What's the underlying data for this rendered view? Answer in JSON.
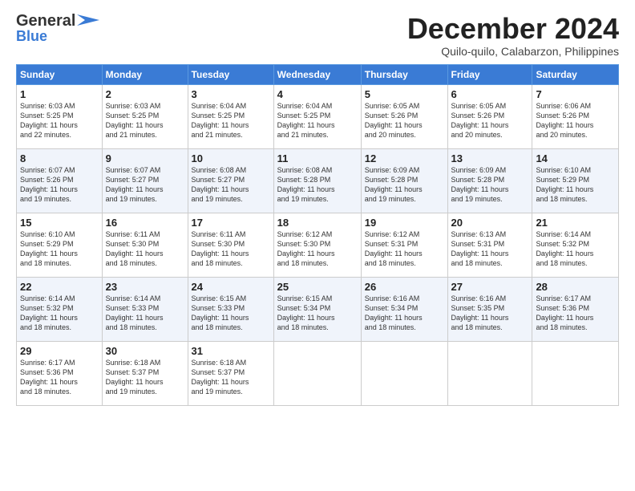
{
  "header": {
    "logo_general": "General",
    "logo_blue": "Blue",
    "month_title": "December 2024",
    "subtitle": "Quilo-quilo, Calabarzon, Philippines"
  },
  "weekdays": [
    "Sunday",
    "Monday",
    "Tuesday",
    "Wednesday",
    "Thursday",
    "Friday",
    "Saturday"
  ],
  "weeks": [
    [
      {
        "day": "1",
        "info": "Sunrise: 6:03 AM\nSunset: 5:25 PM\nDaylight: 11 hours\nand 22 minutes."
      },
      {
        "day": "2",
        "info": "Sunrise: 6:03 AM\nSunset: 5:25 PM\nDaylight: 11 hours\nand 21 minutes."
      },
      {
        "day": "3",
        "info": "Sunrise: 6:04 AM\nSunset: 5:25 PM\nDaylight: 11 hours\nand 21 minutes."
      },
      {
        "day": "4",
        "info": "Sunrise: 6:04 AM\nSunset: 5:25 PM\nDaylight: 11 hours\nand 21 minutes."
      },
      {
        "day": "5",
        "info": "Sunrise: 6:05 AM\nSunset: 5:26 PM\nDaylight: 11 hours\nand 20 minutes."
      },
      {
        "day": "6",
        "info": "Sunrise: 6:05 AM\nSunset: 5:26 PM\nDaylight: 11 hours\nand 20 minutes."
      },
      {
        "day": "7",
        "info": "Sunrise: 6:06 AM\nSunset: 5:26 PM\nDaylight: 11 hours\nand 20 minutes."
      }
    ],
    [
      {
        "day": "8",
        "info": "Sunrise: 6:07 AM\nSunset: 5:26 PM\nDaylight: 11 hours\nand 19 minutes."
      },
      {
        "day": "9",
        "info": "Sunrise: 6:07 AM\nSunset: 5:27 PM\nDaylight: 11 hours\nand 19 minutes."
      },
      {
        "day": "10",
        "info": "Sunrise: 6:08 AM\nSunset: 5:27 PM\nDaylight: 11 hours\nand 19 minutes."
      },
      {
        "day": "11",
        "info": "Sunrise: 6:08 AM\nSunset: 5:28 PM\nDaylight: 11 hours\nand 19 minutes."
      },
      {
        "day": "12",
        "info": "Sunrise: 6:09 AM\nSunset: 5:28 PM\nDaylight: 11 hours\nand 19 minutes."
      },
      {
        "day": "13",
        "info": "Sunrise: 6:09 AM\nSunset: 5:28 PM\nDaylight: 11 hours\nand 19 minutes."
      },
      {
        "day": "14",
        "info": "Sunrise: 6:10 AM\nSunset: 5:29 PM\nDaylight: 11 hours\nand 18 minutes."
      }
    ],
    [
      {
        "day": "15",
        "info": "Sunrise: 6:10 AM\nSunset: 5:29 PM\nDaylight: 11 hours\nand 18 minutes."
      },
      {
        "day": "16",
        "info": "Sunrise: 6:11 AM\nSunset: 5:30 PM\nDaylight: 11 hours\nand 18 minutes."
      },
      {
        "day": "17",
        "info": "Sunrise: 6:11 AM\nSunset: 5:30 PM\nDaylight: 11 hours\nand 18 minutes."
      },
      {
        "day": "18",
        "info": "Sunrise: 6:12 AM\nSunset: 5:30 PM\nDaylight: 11 hours\nand 18 minutes."
      },
      {
        "day": "19",
        "info": "Sunrise: 6:12 AM\nSunset: 5:31 PM\nDaylight: 11 hours\nand 18 minutes."
      },
      {
        "day": "20",
        "info": "Sunrise: 6:13 AM\nSunset: 5:31 PM\nDaylight: 11 hours\nand 18 minutes."
      },
      {
        "day": "21",
        "info": "Sunrise: 6:14 AM\nSunset: 5:32 PM\nDaylight: 11 hours\nand 18 minutes."
      }
    ],
    [
      {
        "day": "22",
        "info": "Sunrise: 6:14 AM\nSunset: 5:32 PM\nDaylight: 11 hours\nand 18 minutes."
      },
      {
        "day": "23",
        "info": "Sunrise: 6:14 AM\nSunset: 5:33 PM\nDaylight: 11 hours\nand 18 minutes."
      },
      {
        "day": "24",
        "info": "Sunrise: 6:15 AM\nSunset: 5:33 PM\nDaylight: 11 hours\nand 18 minutes."
      },
      {
        "day": "25",
        "info": "Sunrise: 6:15 AM\nSunset: 5:34 PM\nDaylight: 11 hours\nand 18 minutes."
      },
      {
        "day": "26",
        "info": "Sunrise: 6:16 AM\nSunset: 5:34 PM\nDaylight: 11 hours\nand 18 minutes."
      },
      {
        "day": "27",
        "info": "Sunrise: 6:16 AM\nSunset: 5:35 PM\nDaylight: 11 hours\nand 18 minutes."
      },
      {
        "day": "28",
        "info": "Sunrise: 6:17 AM\nSunset: 5:36 PM\nDaylight: 11 hours\nand 18 minutes."
      }
    ],
    [
      {
        "day": "29",
        "info": "Sunrise: 6:17 AM\nSunset: 5:36 PM\nDaylight: 11 hours\nand 18 minutes."
      },
      {
        "day": "30",
        "info": "Sunrise: 6:18 AM\nSunset: 5:37 PM\nDaylight: 11 hours\nand 19 minutes."
      },
      {
        "day": "31",
        "info": "Sunrise: 6:18 AM\nSunset: 5:37 PM\nDaylight: 11 hours\nand 19 minutes."
      },
      null,
      null,
      null,
      null
    ]
  ]
}
